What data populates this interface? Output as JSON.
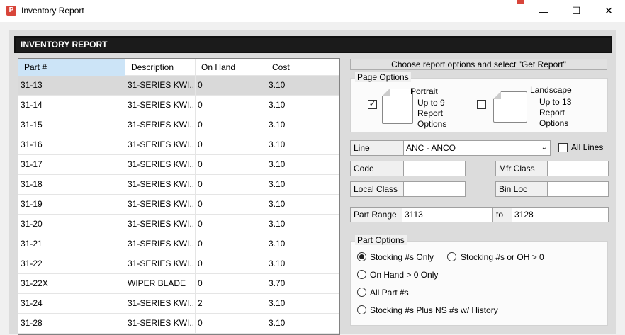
{
  "window": {
    "title": "Inventory Report",
    "app_icon_letter": "P"
  },
  "controls": {
    "minimize": "—",
    "maximize": "☐",
    "close": "✕"
  },
  "header": {
    "title": "INVENTORY REPORT"
  },
  "grid": {
    "columns": [
      "Part #",
      "Description",
      "On Hand",
      "Cost"
    ],
    "rows": [
      [
        "31-13",
        "31-SERIES KWI...",
        "0",
        "3.10"
      ],
      [
        "31-14",
        "31-SERIES KWI...",
        "0",
        "3.10"
      ],
      [
        "31-15",
        "31-SERIES KWI...",
        "0",
        "3.10"
      ],
      [
        "31-16",
        "31-SERIES KWI...",
        "0",
        "3.10"
      ],
      [
        "31-17",
        "31-SERIES KWI...",
        "0",
        "3.10"
      ],
      [
        "31-18",
        "31-SERIES KWI...",
        "0",
        "3.10"
      ],
      [
        "31-19",
        "31-SERIES KWI...",
        "0",
        "3.10"
      ],
      [
        "31-20",
        "31-SERIES KWI...",
        "0",
        "3.10"
      ],
      [
        "31-21",
        "31-SERIES KWI...",
        "0",
        "3.10"
      ],
      [
        "31-22",
        "31-SERIES KWI...",
        "0",
        "3.10"
      ],
      [
        "31-22X",
        "WIPER BLADE",
        "0",
        "3.70"
      ],
      [
        "31-24",
        "31-SERIES KWI...",
        "2",
        "3.10"
      ],
      [
        "31-28",
        "31-SERIES KWI...",
        "0",
        "3.10"
      ]
    ]
  },
  "options": {
    "choose_button": "Choose report options and select \"Get Report\"",
    "page_options_title": "Page Options",
    "portrait_title": "Portrait",
    "portrait_l1": "Up to 9",
    "portrait_l2": "Report",
    "portrait_l3": "Options",
    "portrait_checked": "✓",
    "landscape_title": "Landscape",
    "landscape_l1": "Up to 13",
    "landscape_l2": "Report",
    "landscape_l3": "Options",
    "line_label": "Line",
    "line_value": "ANC - ANCO",
    "all_lines_label": "All Lines",
    "code_label": "Code",
    "mfr_class_label": "Mfr Class",
    "local_class_label": "Local Class",
    "bin_loc_label": "Bin Loc",
    "part_range_label": "Part Range",
    "part_range_from": "3113",
    "to_label": "to",
    "part_range_to": "3128",
    "part_options_title": "Part Options",
    "radio_stocking_only": "Stocking #s Only",
    "radio_stocking_or_oh": "Stocking #s or OH > 0",
    "radio_on_hand": "On Hand > 0 Only",
    "radio_all_parts": "All Part #s",
    "radio_stocking_plus_ns": "Stocking #s Plus NS #s w/ History"
  }
}
